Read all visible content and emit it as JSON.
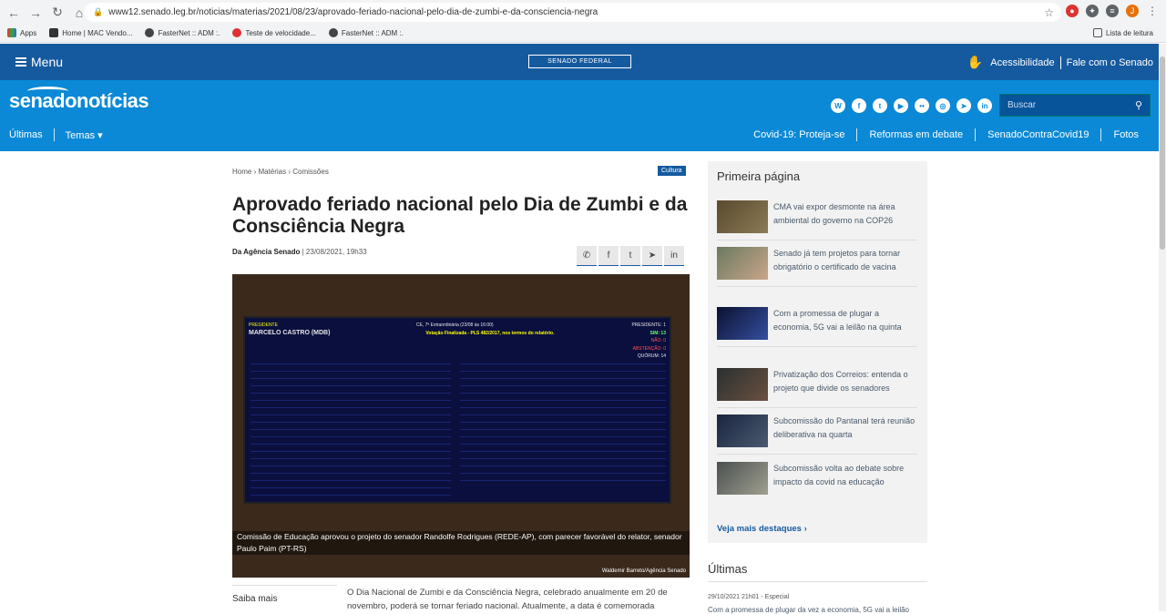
{
  "browser": {
    "url": "www12.senado.leg.br/noticias/materias/2021/08/23/aprovado-feriado-nacional-pelo-dia-de-zumbi-e-da-consciencia-negra",
    "profile_initial": "J",
    "bookmarks": [
      "Apps",
      "Home | MAC Vendo...",
      "FasterNet :: ADM :.",
      "Teste de velocidade...",
      "FasterNet :: ADM :."
    ],
    "reading_list": "Lista de leitura"
  },
  "topbar": {
    "menu": "Menu",
    "senado_federal": "SENADO FEDERAL",
    "accessibility": "Acessibilidade",
    "contact": "Fale com o Senado"
  },
  "header": {
    "logo": "senadonotícias",
    "nav_left": [
      "Últimas",
      "Temas ▾"
    ],
    "search_placeholder": "Buscar",
    "nav_right": [
      "Covid-19: Proteja-se",
      "Reformas em debate",
      "SenadoContraCovid19",
      "Fotos"
    ]
  },
  "article": {
    "breadcrumb": [
      "Home",
      "Matérias",
      "Comissões"
    ],
    "tag": "Cultura",
    "title": "Aprovado feriado nacional pelo Dia de Zumbi e da Consciência Negra",
    "source": "Da Agência Senado",
    "date": "| 23/08/2021, 19h33",
    "caption": "Comissão de Educação aprovou o projeto do senador Randolfe Rodrigues (REDE-AP), com parecer favorável do relator, senador Paulo Paim (PT-RS)",
    "photo_credit": "Waldemir Barreto/Agência Senado",
    "saiba_mais": "Saiba mais",
    "body": "O Dia Nacional de Zumbi e da Consciência Negra, celebrado anualmente em 20 de novembro, poderá se tornar feriado nacional. Atualmente, a data é comemorada"
  },
  "panel": {
    "president_label": "PRESIDENTE",
    "president": "MARCELO CASTRO (MDB)",
    "session": "CE, 7ª Extraordinária (23/08 às 16:00)",
    "result": "Votação Finalizada - PLS 482/2017, nos termos do relatório.",
    "counts": [
      [
        "PRESIDENTE:",
        "1"
      ],
      [
        "SIM:",
        "13"
      ],
      [
        "NÃO:",
        "0"
      ],
      [
        "ABSTENÇÃO:",
        "0"
      ],
      [
        "QUÓRUM:",
        "14"
      ]
    ]
  },
  "sidebar": {
    "title": "Primeira página",
    "items": [
      "CMA vai expor desmonte na área ambiental do governo na COP26",
      "Senado já tem projetos para tornar obrigatório o certificado de vacina",
      "Com a promessa de plugar a economia, 5G vai a leilão na quinta",
      "Privatização dos Correios: entenda o projeto que divide os senadores",
      "Subcomissão do Pantanal terá reunião deliberativa na quarta",
      "Subcomissão volta ao debate sobre impacto da covid na educação"
    ],
    "more": "Veja mais destaques ›"
  },
  "ultimas": {
    "title": "Últimas",
    "date": "29/10/2021 21h01",
    "category": "- Especial",
    "first": "Com a promessa de plugar da vez a economia, 5G vai a leilão"
  }
}
